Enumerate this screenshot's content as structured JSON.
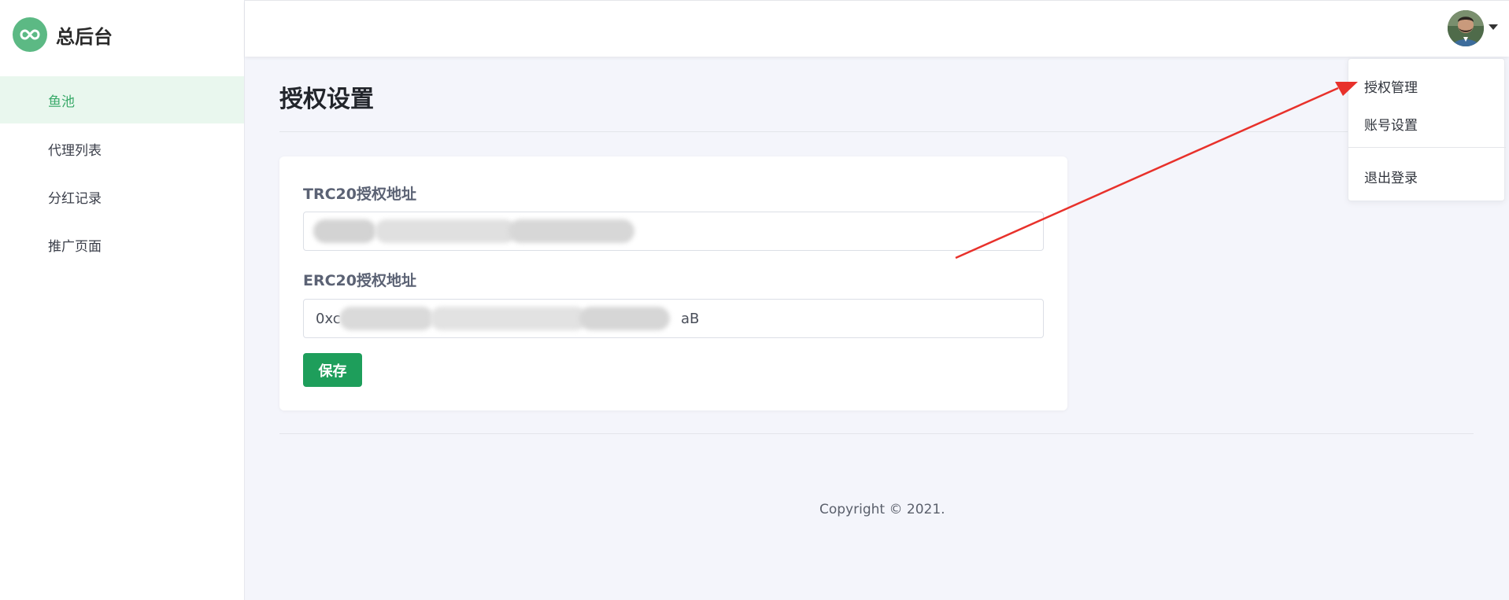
{
  "brand": {
    "title": "总后台"
  },
  "sidebar": {
    "items": [
      {
        "label": "鱼池",
        "active": true
      },
      {
        "label": "代理列表"
      },
      {
        "label": "分红记录"
      },
      {
        "label": "推广页面"
      }
    ]
  },
  "main": {
    "title": "授权设置",
    "trc20": {
      "label": "TRC20授权地址"
    },
    "erc20": {
      "label": "ERC20授权地址",
      "value_prefix": "0xc",
      "value_suffix": "aB"
    },
    "save_label": "保存"
  },
  "footer": {
    "copyright": "Copyright © 2021."
  },
  "user_menu": {
    "items": [
      "授权管理",
      "账号设置"
    ],
    "logout": "退出登录"
  },
  "colors": {
    "accent": "#1e9e5b",
    "sidebar_active_bg": "#e9f7ee",
    "sidebar_active_text": "#3aaa6a",
    "annotation_arrow": "#e8312b"
  }
}
